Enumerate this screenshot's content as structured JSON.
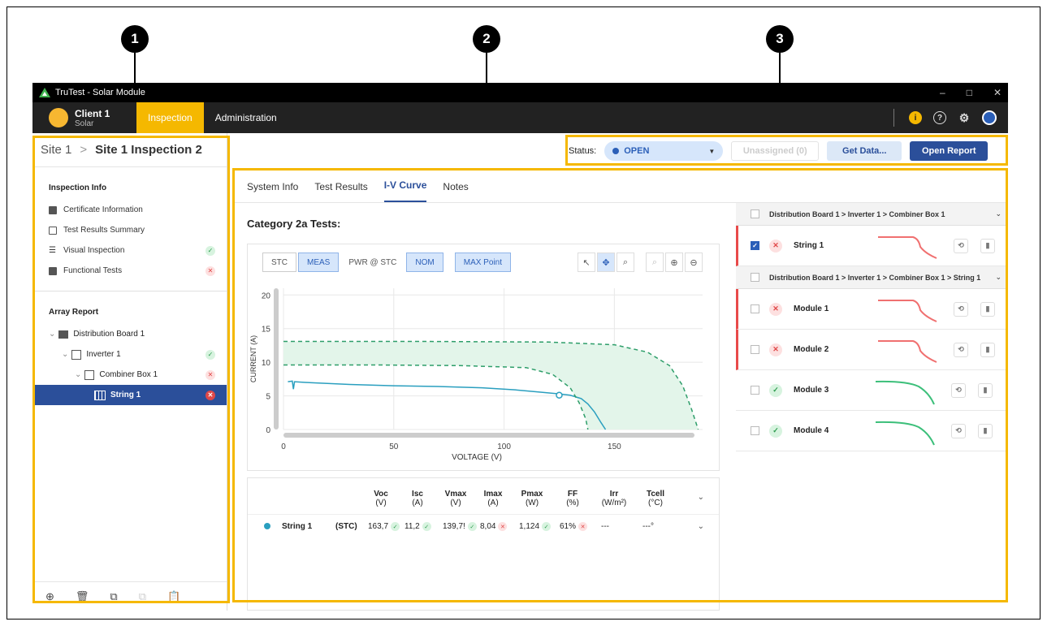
{
  "callouts": [
    "1",
    "2",
    "3"
  ],
  "window": {
    "title": "TruTest - Solar Module",
    "minimize": "–",
    "maximize": "□",
    "close": "✕"
  },
  "nav": {
    "client_name": "Client 1",
    "client_sub": "Solar",
    "tabs": [
      "Inspection",
      "Administration"
    ],
    "icons": [
      "info-icon",
      "help-icon",
      "gear-icon",
      "account-icon"
    ]
  },
  "breadcrumb": {
    "site": "Site 1",
    "separator": ">",
    "current": "Site 1 Inspection 2"
  },
  "sidebar": {
    "inspection_title": "Inspection Info",
    "items": [
      {
        "label": "Certificate Information",
        "status": ""
      },
      {
        "label": "Test Results Summary",
        "status": ""
      },
      {
        "label": "Visual Inspection",
        "status": "ok"
      },
      {
        "label": "Functional Tests",
        "status": "bad"
      }
    ],
    "array_title": "Array Report",
    "tree": [
      {
        "label": "Distribution Board 1",
        "status": ""
      },
      {
        "label": "Inverter 1",
        "status": "ok"
      },
      {
        "label": "Combiner Box 1",
        "status": "bad"
      },
      {
        "label": "String 1",
        "status": "bad"
      }
    ]
  },
  "status_bar": {
    "label": "Status:",
    "value": "OPEN",
    "unassigned": "Unassigned (0)",
    "get_data": "Get Data...",
    "open_report": "Open Report"
  },
  "tabs": [
    "System Info",
    "Test Results",
    "I-V Curve",
    "Notes"
  ],
  "active_tab": "I-V Curve",
  "category_title": "Category 2a Tests:",
  "chart_toolbar": [
    "STC",
    "MEAS",
    "PWR @ STC",
    "NOM",
    "MAX Point"
  ],
  "chart_data": {
    "type": "line",
    "xlabel": "VOLTAGE (V)",
    "ylabel": "CURRENT (A)",
    "xlim": [
      0,
      190
    ],
    "ylim": [
      0,
      21
    ],
    "xticks": [
      0,
      50,
      100,
      150
    ],
    "yticks": [
      0,
      5,
      10,
      15,
      20
    ],
    "series": [
      {
        "name": "String 1",
        "color": "#2a9fbf",
        "style": "solid",
        "x": [
          2,
          4,
          4.5,
          5,
          10,
          30,
          50,
          70,
          90,
          105,
          115,
          125,
          130,
          135,
          138,
          141,
          144,
          146
        ],
        "y": [
          7.1,
          7.2,
          6.0,
          7.1,
          7.0,
          6.7,
          6.5,
          6.4,
          6.2,
          5.9,
          5.6,
          5.3,
          5.1,
          4.6,
          3.8,
          2.6,
          1.0,
          0
        ]
      },
      {
        "name": "",
        "color": "#2e9e6a",
        "style": "dashed",
        "x": [
          0,
          40,
          80,
          110,
          122,
          130,
          134,
          137,
          138
        ],
        "y": [
          9.6,
          9.6,
          9.5,
          9.2,
          8.2,
          6.2,
          4.0,
          1.6,
          0
        ]
      },
      {
        "name": "",
        "color": "#2e9e6a",
        "style": "dashed",
        "x": [
          0,
          60,
          120,
          150,
          165,
          175,
          181,
          185,
          188
        ],
        "y": [
          13.1,
          13.1,
          13.0,
          12.6,
          11.5,
          9.5,
          6.5,
          3.0,
          0
        ]
      }
    ],
    "max_point": {
      "x": 125,
      "y": 5.1
    }
  },
  "results_table": {
    "headers": [
      {
        "name": "Voc",
        "unit": "(V)"
      },
      {
        "name": "Isc",
        "unit": "(A)"
      },
      {
        "name": "Vmax",
        "unit": "(V)"
      },
      {
        "name": "Imax",
        "unit": "(A)"
      },
      {
        "name": "Pmax",
        "unit": "(W)"
      },
      {
        "name": "FF",
        "unit": "(%)"
      },
      {
        "name": "Irr",
        "unit": "(W/m²)"
      },
      {
        "name": "Tcell",
        "unit": "(°C)"
      }
    ],
    "row": {
      "name": "String 1",
      "mode": "(STC)",
      "values": [
        "163,7",
        "11,2",
        "139,7!",
        "8,04",
        "1,124",
        "61%",
        "---",
        "---°"
      ],
      "statuses": [
        "ok",
        "ok",
        "ok",
        "bad",
        "ok",
        "bad",
        "",
        ""
      ]
    }
  },
  "right_panel": {
    "group1": "Distribution Board 1 > Inverter 1 > Combiner Box 1",
    "group2": "Distribution Board 1 > Inverter 1 > Combiner Box 1 > String 1",
    "string_row": {
      "label": "String 1",
      "status": "bad",
      "checked": true
    },
    "modules": [
      {
        "label": "Module 1",
        "status": "bad"
      },
      {
        "label": "Module 2",
        "status": "bad"
      },
      {
        "label": "Module 3",
        "status": "ok"
      },
      {
        "label": "Module 4",
        "status": "ok"
      }
    ]
  }
}
